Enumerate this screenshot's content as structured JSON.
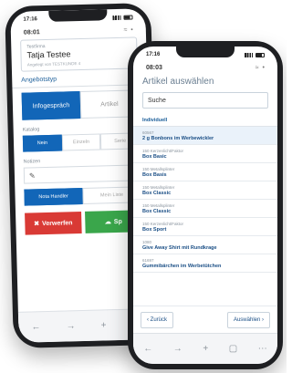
{
  "back_screen": {
    "status_time": "17:16",
    "header_time": "08:01",
    "name_field": {
      "label": "Testfirma",
      "value": "Tatja Testee",
      "hint": "Angelegt von TESTKUNDE 4"
    },
    "section_title": "Angebotstyp",
    "type_options": [
      "Infogespräch",
      "Artikel"
    ],
    "katalog_label": "Katalog",
    "katalog_options": [
      "Nein",
      "Einzeln",
      "Serie"
    ],
    "notes_label": "Notizen",
    "mode_options": [
      "Nota Handler",
      "Mein Liste"
    ],
    "discard_label": "Verwerfen",
    "save_label": "Sp"
  },
  "front_screen": {
    "status_time": "17:16",
    "header_time": "08:03",
    "title": "Artikel auswählen",
    "search_value": "Suche",
    "list_header": "Individuell",
    "items": [
      {
        "code": "60567",
        "name": "2 g Bonbons im Werbewickler"
      },
      {
        "code": "150 Kerzenlicht/Faktor",
        "name": "Box Basic"
      },
      {
        "code": "150 Metallsplinter",
        "name": "Box Basis"
      },
      {
        "code": "150 Metallsplinter",
        "name": "Box Classic"
      },
      {
        "code": "150 Metallsplinter",
        "name": "Box Classic"
      },
      {
        "code": "150 Kerzenlicht/Faktor",
        "name": "Box Sport"
      },
      {
        "code": "1080",
        "name": "Give Away Shirt mit Rundkrage"
      },
      {
        "code": "61697",
        "name": "Gummibärchen im Werbetütchen"
      }
    ],
    "back_button": "Zurück",
    "select_button": "Auswählen"
  },
  "colors": {
    "primary": "#1266b8",
    "danger": "#d93a35",
    "success": "#3aa64b",
    "link": "#1b4f86"
  }
}
